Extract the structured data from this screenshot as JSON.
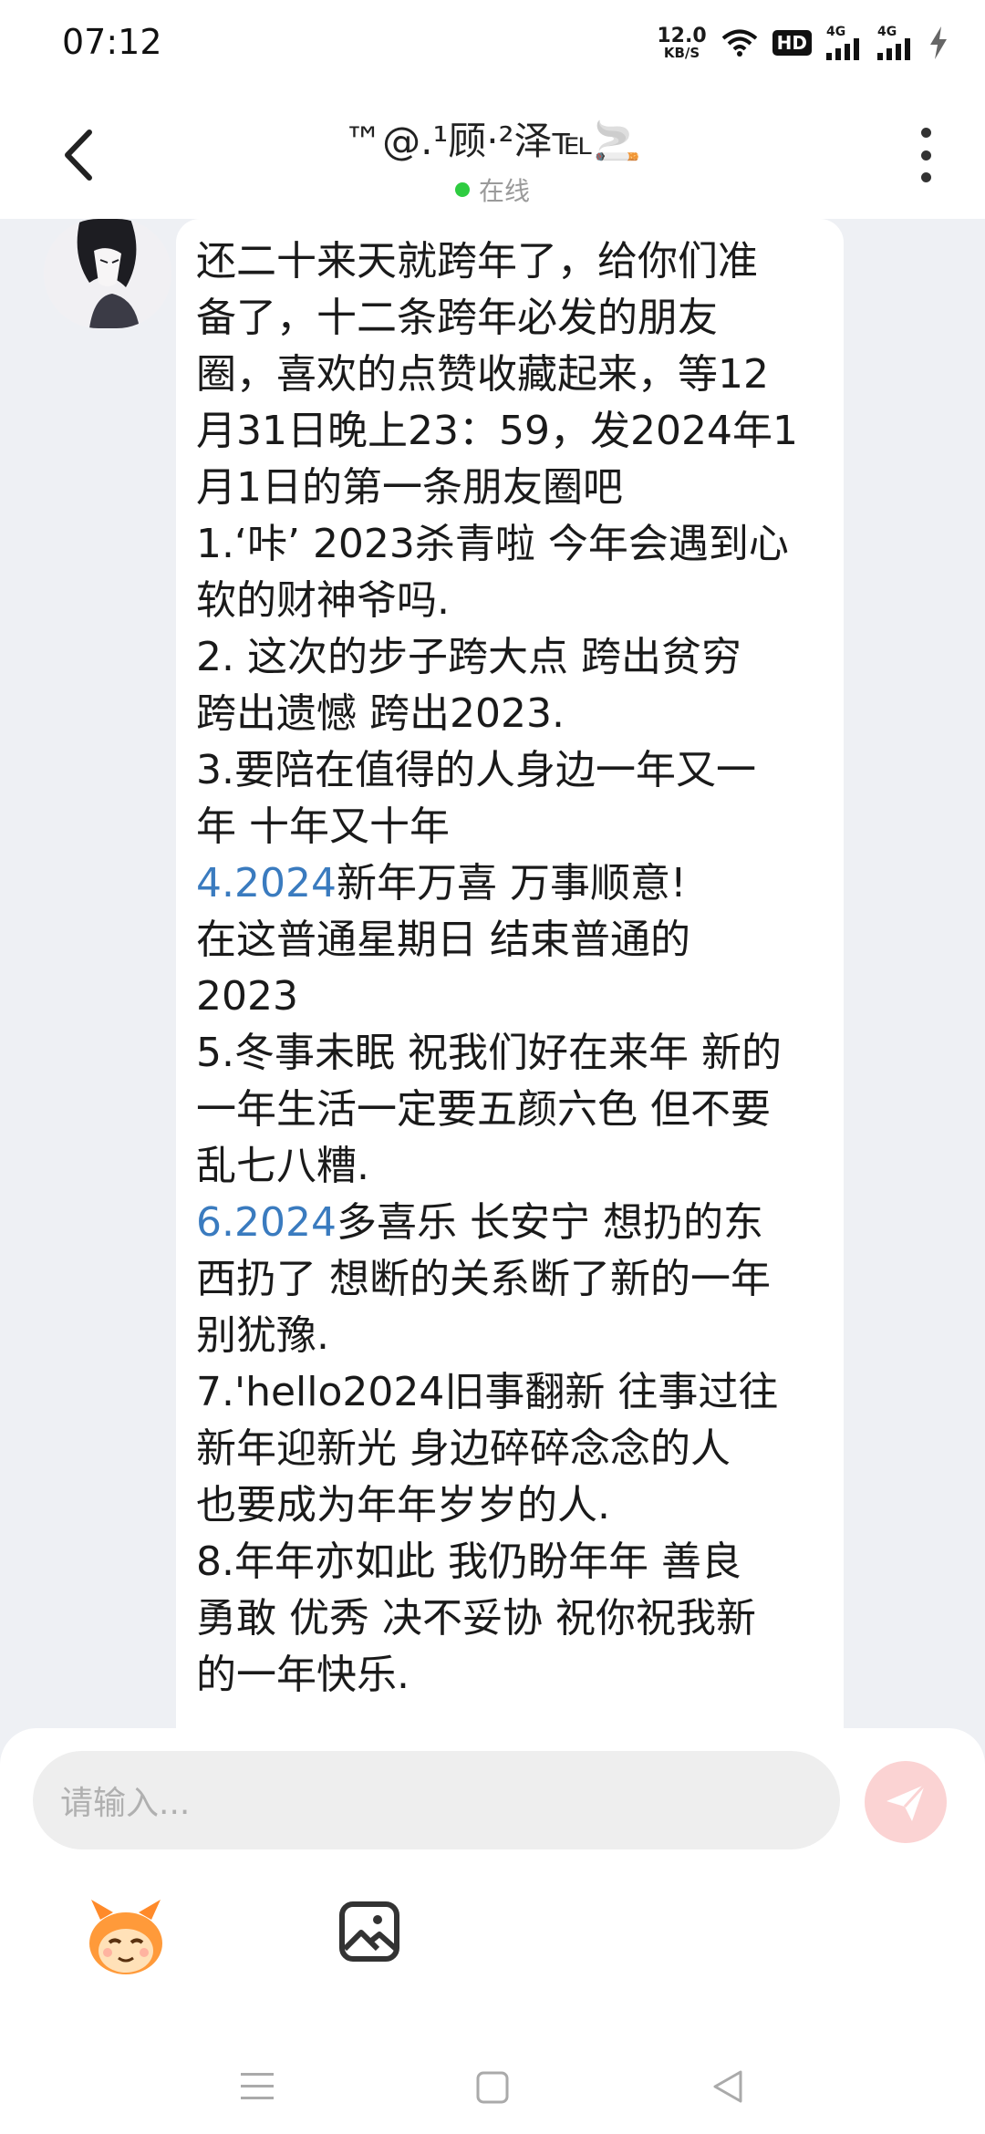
{
  "status_bar": {
    "time": "07:12",
    "speed_value": "12.0",
    "speed_unit": "KB/S",
    "hd_label": "HD",
    "sim1_label": "4G",
    "sim2_label": "4G"
  },
  "header": {
    "title": "™@.¹顾·²泽℡🚬",
    "status": "在线",
    "status_color": "#2ecc40"
  },
  "message": {
    "lines": [
      {
        "text": "还二十来天就跨年了，给你们准"
      },
      {
        "text": "备了，十二条跨年必发的朋友"
      },
      {
        "text": "圈，喜欢的点赞收藏起来，等12"
      },
      {
        "text": "月31日晚上23：59，发2024年1"
      },
      {
        "text": "月1日的第一条朋友圈吧"
      },
      {
        "text": "1.‘咔’ 2023杀青啦 今年会遇到心"
      },
      {
        "text": "软的财神爷吗."
      },
      {
        "text": "2. 这次的步子跨大点 跨出贫穷"
      },
      {
        "text": "跨出遗憾 跨出2023."
      },
      {
        "text": "3.要陪在值得的人身边一年又一"
      },
      {
        "text": "年 十年又十年"
      },
      {
        "link": "4.2024",
        "text": "新年万喜 万事顺意!"
      },
      {
        "text": "在这普通星期日 结束普通的"
      },
      {
        "text": "2023"
      },
      {
        "text": "5.冬事未眠 祝我们好在来年 新的"
      },
      {
        "text": "一年生活一定要五颜六色 但不要"
      },
      {
        "text": "乱七八糟."
      },
      {
        "link": "6.2024",
        "text": "多喜乐 长安宁 想扔的东"
      },
      {
        "text": "西扔了 想断的关系断了新的一年"
      },
      {
        "text": "别犹豫."
      },
      {
        "text": "7.'hello2024旧事翻新 往事过往"
      },
      {
        "text": "新年迎新光 身边碎碎念念的人"
      },
      {
        "text": "也要成为年年岁岁的人."
      },
      {
        "text": "8.年年亦如此 我仍盼年年 善良"
      },
      {
        "text": "勇敢 优秀 决不妥协 祝你祝我新"
      },
      {
        "text": "的一年快乐."
      }
    ]
  },
  "composer": {
    "placeholder": "请输入...",
    "send_color": "#fbd3d3"
  },
  "icons": {
    "back": "chevron-left-icon",
    "more": "more-vertical-icon",
    "send": "send-icon",
    "sticker": "sticker-icon",
    "image": "image-icon"
  }
}
